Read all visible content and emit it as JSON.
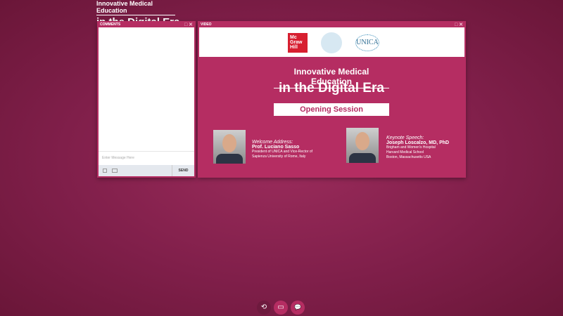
{
  "brand": {
    "line1": "Innovative Medical Education",
    "line2": "in the Digital Era"
  },
  "comments": {
    "title": "COMMENTS",
    "placeholder": "Enter Message Here",
    "send": "SEND"
  },
  "video": {
    "title": "VIDEO",
    "logos": {
      "mcgraw": "McGraw Hill",
      "unica": "UNICA"
    },
    "slide": {
      "title1": "Innovative Medical Education",
      "title2": "in the Digital Era",
      "session": "Opening Session",
      "speakers": [
        {
          "role": "Welcome Address:",
          "name": "Prof. Luciano Sasso",
          "lines": [
            "President of UNICA and Vice-Rector of",
            "Sapienza University of Rome, Italy"
          ]
        },
        {
          "role": "Keynote Speech:",
          "name": "Joseph Loscalzo, MD, PhD",
          "lines": [
            "Brigham and Women's Hospital",
            "Harvard Medical School",
            "Boston, Massachusetts  USA"
          ]
        }
      ]
    }
  },
  "controls": {
    "refresh": "⟲",
    "screen": "▭",
    "chat": "💬"
  }
}
